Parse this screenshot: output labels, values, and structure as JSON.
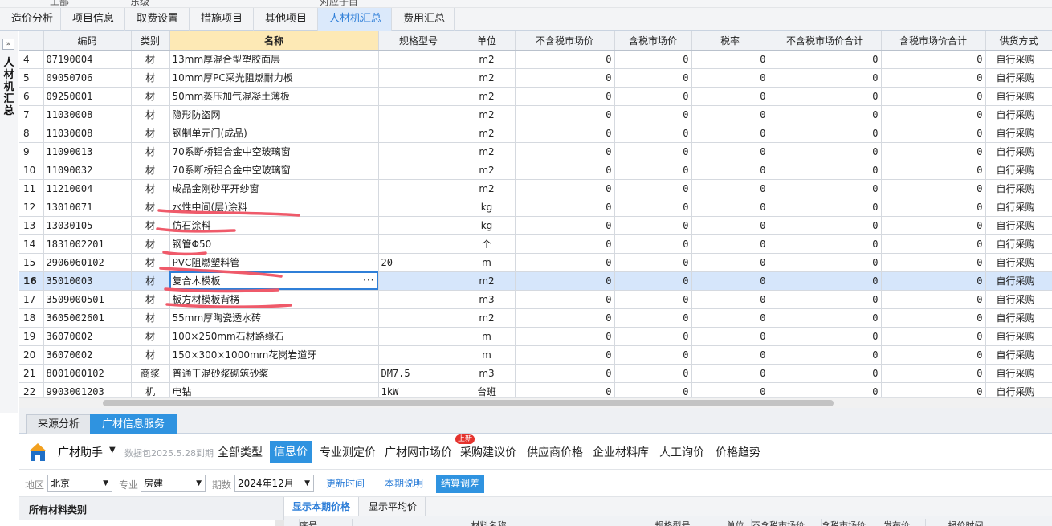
{
  "top_strip": [
    "工部",
    "东级",
    "对应子目"
  ],
  "tabs": [
    {
      "label": "造价分析",
      "active": false
    },
    {
      "label": "项目信息",
      "active": false
    },
    {
      "label": "取费设置",
      "active": false
    },
    {
      "label": "措施项目",
      "active": false
    },
    {
      "label": "其他项目",
      "active": false
    },
    {
      "label": "人材机汇总",
      "active": true
    },
    {
      "label": "费用汇总",
      "active": false
    }
  ],
  "left_panel": {
    "collapse": "»",
    "title": "人材机汇总"
  },
  "grid": {
    "headers": [
      "",
      "编码",
      "类别",
      "名称",
      "规格型号",
      "单位",
      "不含税市场价",
      "含税市场价",
      "税率",
      "不含税市场价合计",
      "含税市场价合计",
      "供货方式"
    ],
    "rows": [
      [
        "4",
        "07190004",
        "材",
        "13mm厚混合型塑胶面层",
        "",
        "m2",
        "0",
        "0",
        "0",
        "0",
        "0",
        "自行采购"
      ],
      [
        "5",
        "09050706",
        "材",
        "10mm厚PC采光阻燃耐力板",
        "",
        "m2",
        "0",
        "0",
        "0",
        "0",
        "0",
        "自行采购"
      ],
      [
        "6",
        "09250001",
        "材",
        "50mm蒸压加气混凝土薄板",
        "",
        "m2",
        "0",
        "0",
        "0",
        "0",
        "0",
        "自行采购"
      ],
      [
        "7",
        "11030008",
        "材",
        "隐形防盗网",
        "",
        "m2",
        "0",
        "0",
        "0",
        "0",
        "0",
        "自行采购"
      ],
      [
        "8",
        "11030008",
        "材",
        "钢制单元门(成品)",
        "",
        "m2",
        "0",
        "0",
        "0",
        "0",
        "0",
        "自行采购"
      ],
      [
        "9",
        "11090013",
        "材",
        "70系断桥铝合金中空玻璃窗",
        "",
        "m2",
        "0",
        "0",
        "0",
        "0",
        "0",
        "自行采购"
      ],
      [
        "10",
        "11090032",
        "材",
        "70系断桥铝合金中空玻璃窗",
        "",
        "m2",
        "0",
        "0",
        "0",
        "0",
        "0",
        "自行采购"
      ],
      [
        "11",
        "11210004",
        "材",
        "成品金刚砂平开纱窗",
        "",
        "m2",
        "0",
        "0",
        "0",
        "0",
        "0",
        "自行采购"
      ],
      [
        "12",
        "13010071",
        "材",
        "水性中间(层)涂料",
        "",
        "kg",
        "0",
        "0",
        "0",
        "0",
        "0",
        "自行采购"
      ],
      [
        "13",
        "13030105",
        "材",
        "仿石涂料",
        "",
        "kg",
        "0",
        "0",
        "0",
        "0",
        "0",
        "自行采购"
      ],
      [
        "14",
        "1831002201",
        "材",
        "钢管Φ50",
        "",
        "个",
        "0",
        "0",
        "0",
        "0",
        "0",
        "自行采购"
      ],
      [
        "15",
        "2906060102",
        "材",
        "PVC阻燃塑料管",
        "20",
        "m",
        "0",
        "0",
        "0",
        "0",
        "0",
        "自行采购"
      ],
      [
        "16",
        "35010003",
        "材",
        "复合木模板",
        "",
        "m2",
        "0",
        "0",
        "0",
        "0",
        "0",
        "自行采购"
      ],
      [
        "17",
        "3509000501",
        "材",
        "板方材模板背楞",
        "",
        "m3",
        "0",
        "0",
        "0",
        "0",
        "0",
        "自行采购"
      ],
      [
        "18",
        "3605002601",
        "材",
        "55mm厚陶瓷透水砖",
        "",
        "m2",
        "0",
        "0",
        "0",
        "0",
        "0",
        "自行采购"
      ],
      [
        "19",
        "36070002",
        "材",
        "100×250mm石材路缘石",
        "",
        "m",
        "0",
        "0",
        "0",
        "0",
        "0",
        "自行采购"
      ],
      [
        "20",
        "36070002",
        "材",
        "150×300×1000mm花岗岩道牙",
        "",
        "m",
        "0",
        "0",
        "0",
        "0",
        "0",
        "自行采购"
      ],
      [
        "21",
        "8001000102",
        "商浆",
        "普通干混砂浆砌筑砂浆",
        "DM7.5",
        "m3",
        "0",
        "0",
        "0",
        "0",
        "0",
        "自行采购"
      ],
      [
        "22",
        "9903001203",
        "机",
        "电钻",
        "1kW",
        "台班",
        "0",
        "0",
        "0",
        "0",
        "0",
        "自行采购"
      ]
    ],
    "selected_row": "16",
    "name_cell_ellipsis": "···"
  },
  "bottom_tabs": [
    {
      "label": "来源分析",
      "active": false
    },
    {
      "label": "广材信息服务",
      "active": true
    }
  ],
  "assistant": {
    "name": "广材助手",
    "caret": "▼",
    "package_note": "数据包2025.5.28到期",
    "price_types": [
      {
        "label": "全部类型",
        "active": false
      },
      {
        "label": "信息价",
        "active": true
      },
      {
        "label": "专业测定价",
        "active": false
      },
      {
        "label": "广材网市场价",
        "active": false
      },
      {
        "label": "采购建议价",
        "active": false
      },
      {
        "label": "供应商价格",
        "active": false
      },
      {
        "label": "企业材料库",
        "active": false
      },
      {
        "label": "人工询价",
        "active": false
      },
      {
        "label": "价格趋势",
        "active": false
      }
    ],
    "new_badge": "上新"
  },
  "filters": {
    "region_label": "地区",
    "region_value": "北京",
    "major_label": "专业",
    "major_value": "房建",
    "period_label": "期数",
    "period_value": "2024年12月",
    "btn_update": "更新时间",
    "btn_note": "本期说明",
    "btn_settle": "结算调差"
  },
  "category_panel": {
    "title": "所有材料类别"
  },
  "price_panel": {
    "tabs": [
      {
        "label": "显示本期价格",
        "active": true
      },
      {
        "label": "显示平均价",
        "active": false
      }
    ],
    "headers": [
      "序号",
      "材料名称",
      "规格型号",
      "单位",
      "不含税市场价",
      "含税市场价",
      "发布价",
      "报价时间"
    ]
  },
  "colors": {
    "accent": "#2f93e0",
    "selected_row": "#d6e6fb",
    "name_header": "#fde9b5",
    "annotation_red": "#ef5a6a"
  }
}
